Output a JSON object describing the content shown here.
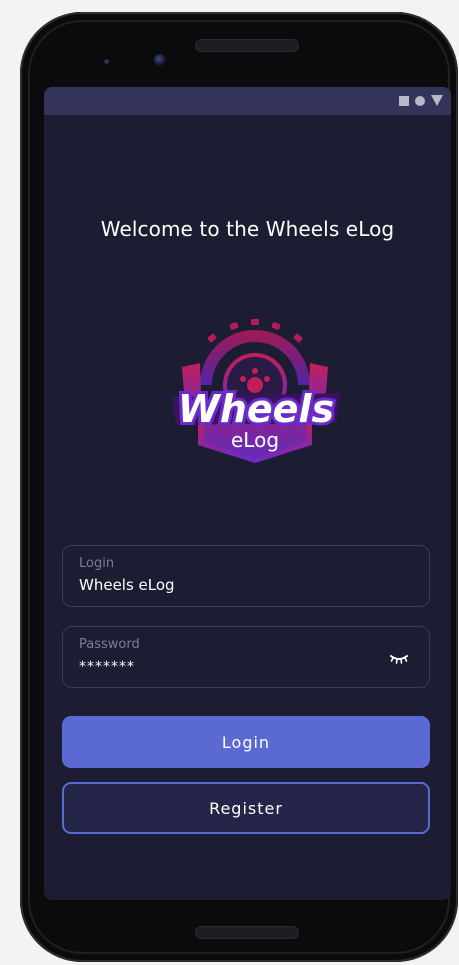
{
  "status_bar": {
    "icons": [
      "square-icon",
      "circle-icon",
      "triangle-icon"
    ]
  },
  "welcome": {
    "title": "Welcome to the Wheels eLog"
  },
  "logo": {
    "brand_main": "Wheels",
    "brand_sub": "eLog",
    "colors": {
      "top": "#c21e5a",
      "bottom": "#6a2cc9",
      "text": "#ffffff"
    }
  },
  "login_field": {
    "label": "Login",
    "value": "Wheels eLog"
  },
  "password_field": {
    "label": "Password",
    "value": "*******",
    "toggle_icon": "eye-closed-icon"
  },
  "buttons": {
    "login_label": "Login",
    "register_label": "Register"
  },
  "colors": {
    "background": "#1c1c33",
    "status_bar": "#34345a",
    "accent": "#5a6ad2",
    "field_border": "#3a3a5c"
  }
}
